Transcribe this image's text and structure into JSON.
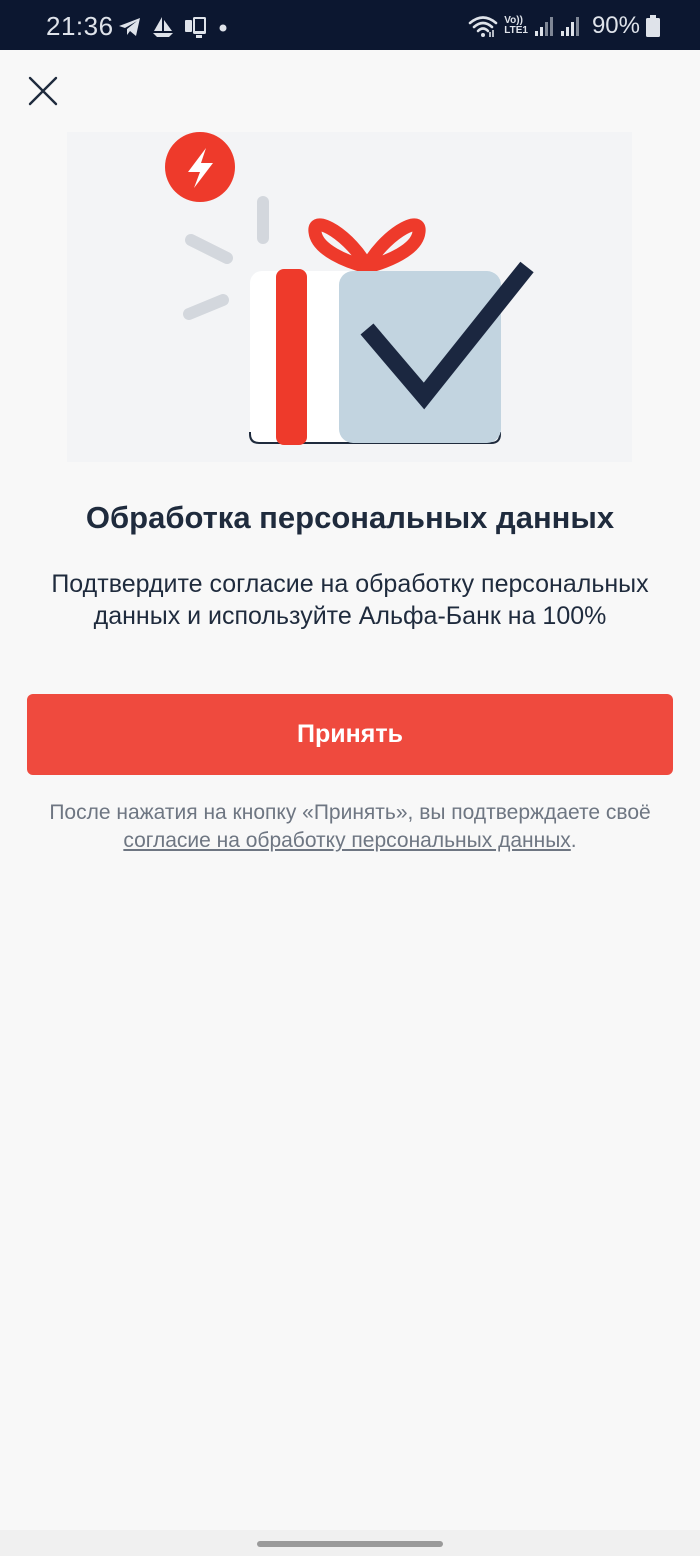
{
  "status_bar": {
    "time": "21:36",
    "icons_left": [
      "telegram-icon",
      "sailboat-icon",
      "phone-tablet-icon",
      "notification-dot-icon"
    ],
    "volte_top": "Vo))",
    "volte_bottom": "LTE1",
    "battery": "90%"
  },
  "dialog": {
    "close_icon": "close-icon",
    "title": "Обработка персональных данных",
    "description": "Подтвердите согласие на обработку персональных данных и используйте Альфа-Банк на 100%",
    "accept_label": "Принять",
    "footnote_prefix": "После нажатия на кнопку «Принять», вы подтверждаете своё ",
    "footnote_link": "согласие на обработку персональных данных",
    "footnote_suffix": "."
  },
  "colors": {
    "accent": "#ef4a3e",
    "status_bar": "#0c1730",
    "text_primary": "#1f2b3d",
    "text_secondary": "#6e7682"
  }
}
